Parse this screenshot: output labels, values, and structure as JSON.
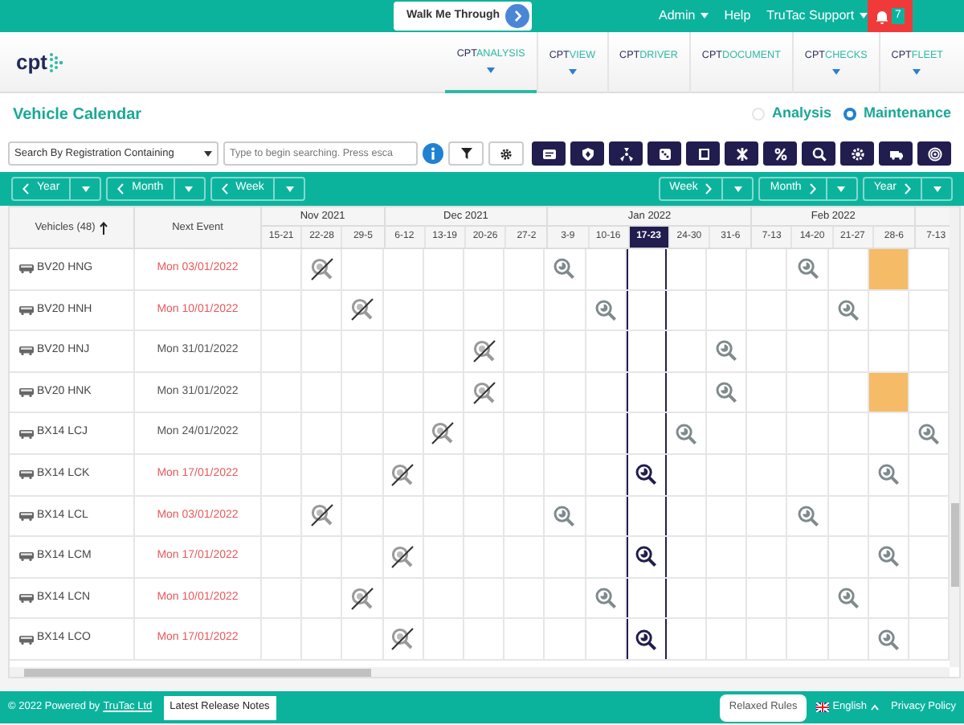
{
  "top_bar": {
    "walkthrough": "Walk Me Through",
    "menus": [
      {
        "label": "Admin",
        "dropdown": true
      },
      {
        "label": "Help",
        "dropdown": false
      },
      {
        "label": "TruTac Support",
        "dropdown": true
      }
    ],
    "notifications": "7"
  },
  "logo": "cpt",
  "nav": [
    {
      "prefix": "CPT",
      "label": "ANALYSIS",
      "selected": true,
      "dropdown": true
    },
    {
      "prefix": "CPT",
      "label": "VIEW",
      "selected": false,
      "dropdown": true
    },
    {
      "prefix": "CPT",
      "label": "DRIVER",
      "selected": false,
      "dropdown": false
    },
    {
      "prefix": "CPT",
      "label": "DOCUMENT",
      "selected": false,
      "dropdown": false
    },
    {
      "prefix": "CPT",
      "label": "CHECKS",
      "selected": false,
      "dropdown": true
    },
    {
      "prefix": "CPT",
      "label": "FLEET",
      "selected": false,
      "dropdown": true
    }
  ],
  "page_title": "Vehicle Calendar",
  "modes": [
    {
      "label": "Analysis",
      "selected": false
    },
    {
      "label": "Maintenance",
      "selected": true
    }
  ],
  "search": {
    "mode": "Search By Registration Containing",
    "placeholder": "Type to begin searching. Press esca"
  },
  "period_nav": {
    "back": [
      {
        "label": "Year"
      },
      {
        "label": "Month"
      },
      {
        "label": "Week"
      }
    ],
    "forward": [
      {
        "label": "Week"
      },
      {
        "label": "Month"
      },
      {
        "label": "Year"
      }
    ]
  },
  "calendar": {
    "columns": {
      "vehicles": "Vehicles (48)",
      "next_event": "Next Event"
    },
    "months": [
      {
        "label": "Nov 2021",
        "weeks": [
          {
            "label": "15-21",
            "selected": false
          },
          {
            "label": "22-28",
            "selected": false
          },
          {
            "label": "29-5",
            "selected": false
          }
        ]
      },
      {
        "label": "Dec 2021",
        "weeks": [
          {
            "label": "6-12",
            "selected": false
          },
          {
            "label": "13-19",
            "selected": false
          },
          {
            "label": "20-26",
            "selected": false
          },
          {
            "label": "27-2",
            "selected": false
          }
        ]
      },
      {
        "label": "Jan 2022",
        "weeks": [
          {
            "label": "3-9",
            "selected": false
          },
          {
            "label": "10-16",
            "selected": false
          },
          {
            "label": "17-23",
            "selected": true
          },
          {
            "label": "24-30",
            "selected": false
          },
          {
            "label": "31-6",
            "selected": false
          }
        ]
      },
      {
        "label": "Feb 2022",
        "weeks": [
          {
            "label": "7-13",
            "selected": false
          },
          {
            "label": "14-20",
            "selected": false
          },
          {
            "label": "21-27",
            "selected": false
          },
          {
            "label": "28-6",
            "selected": false
          }
        ]
      },
      {
        "weeks": [
          {
            "label": "7-13",
            "selected": false
          }
        ]
      }
    ],
    "rows": [
      {
        "vehicle": "BV20 HNG",
        "next_event": "Mon 03/01/2022",
        "overdue": true,
        "cells": [
          {
            "kind": "none"
          },
          {
            "kind": "cancelled"
          },
          {
            "kind": "none"
          },
          {
            "kind": "none"
          },
          {
            "kind": "none"
          },
          {
            "kind": "none"
          },
          {
            "kind": "none"
          },
          {
            "kind": "inspection"
          },
          {
            "kind": "none"
          },
          {
            "kind": "none"
          },
          {
            "kind": "none"
          },
          {
            "kind": "none"
          },
          {
            "kind": "none"
          },
          {
            "kind": "inspection"
          },
          {
            "kind": "none"
          },
          {
            "kind": "due"
          },
          {
            "kind": "none"
          }
        ]
      },
      {
        "vehicle": "BV20 HNH",
        "next_event": "Mon 10/01/2022",
        "overdue": true,
        "cells": [
          {
            "kind": "none"
          },
          {
            "kind": "none"
          },
          {
            "kind": "cancelled"
          },
          {
            "kind": "none"
          },
          {
            "kind": "none"
          },
          {
            "kind": "none"
          },
          {
            "kind": "none"
          },
          {
            "kind": "none"
          },
          {
            "kind": "inspection"
          },
          {
            "kind": "none"
          },
          {
            "kind": "none"
          },
          {
            "kind": "none"
          },
          {
            "kind": "none"
          },
          {
            "kind": "none"
          },
          {
            "kind": "inspection"
          },
          {
            "kind": "none"
          },
          {
            "kind": "none"
          }
        ]
      },
      {
        "vehicle": "BV20 HNJ",
        "next_event": "Mon 31/01/2022",
        "overdue": false,
        "cells": [
          {
            "kind": "none"
          },
          {
            "kind": "none"
          },
          {
            "kind": "none"
          },
          {
            "kind": "none"
          },
          {
            "kind": "none"
          },
          {
            "kind": "cancelled"
          },
          {
            "kind": "none"
          },
          {
            "kind": "none"
          },
          {
            "kind": "none"
          },
          {
            "kind": "none"
          },
          {
            "kind": "none"
          },
          {
            "kind": "inspection"
          },
          {
            "kind": "none"
          },
          {
            "kind": "none"
          },
          {
            "kind": "none"
          },
          {
            "kind": "none"
          },
          {
            "kind": "none"
          }
        ]
      },
      {
        "vehicle": "BV20 HNK",
        "next_event": "Mon 31/01/2022",
        "overdue": false,
        "cells": [
          {
            "kind": "none"
          },
          {
            "kind": "none"
          },
          {
            "kind": "none"
          },
          {
            "kind": "none"
          },
          {
            "kind": "none"
          },
          {
            "kind": "cancelled"
          },
          {
            "kind": "none"
          },
          {
            "kind": "none"
          },
          {
            "kind": "none"
          },
          {
            "kind": "none"
          },
          {
            "kind": "none"
          },
          {
            "kind": "inspection"
          },
          {
            "kind": "none"
          },
          {
            "kind": "none"
          },
          {
            "kind": "none"
          },
          {
            "kind": "due"
          },
          {
            "kind": "none"
          }
        ]
      },
      {
        "vehicle": "BX14 LCJ",
        "next_event": "Mon 24/01/2022",
        "overdue": false,
        "cells": [
          {
            "kind": "none"
          },
          {
            "kind": "none"
          },
          {
            "kind": "none"
          },
          {
            "kind": "none"
          },
          {
            "kind": "cancelled"
          },
          {
            "kind": "none"
          },
          {
            "kind": "none"
          },
          {
            "kind": "none"
          },
          {
            "kind": "none"
          },
          {
            "kind": "none"
          },
          {
            "kind": "inspection"
          },
          {
            "kind": "none"
          },
          {
            "kind": "none"
          },
          {
            "kind": "none"
          },
          {
            "kind": "none"
          },
          {
            "kind": "none"
          },
          {
            "kind": "inspection"
          }
        ]
      },
      {
        "vehicle": "BX14 LCK",
        "next_event": "Mon 17/01/2022",
        "overdue": true,
        "cells": [
          {
            "kind": "none"
          },
          {
            "kind": "none"
          },
          {
            "kind": "none"
          },
          {
            "kind": "cancelled"
          },
          {
            "kind": "none"
          },
          {
            "kind": "none"
          },
          {
            "kind": "none"
          },
          {
            "kind": "none"
          },
          {
            "kind": "none"
          },
          {
            "kind": "inspection"
          },
          {
            "kind": "none"
          },
          {
            "kind": "none"
          },
          {
            "kind": "none"
          },
          {
            "kind": "none"
          },
          {
            "kind": "none"
          },
          {
            "kind": "inspection"
          },
          {
            "kind": "none"
          }
        ]
      },
      {
        "vehicle": "BX14 LCL",
        "next_event": "Mon 03/01/2022",
        "overdue": true,
        "cells": [
          {
            "kind": "none"
          },
          {
            "kind": "cancelled"
          },
          {
            "kind": "none"
          },
          {
            "kind": "none"
          },
          {
            "kind": "none"
          },
          {
            "kind": "none"
          },
          {
            "kind": "none"
          },
          {
            "kind": "inspection"
          },
          {
            "kind": "none"
          },
          {
            "kind": "none"
          },
          {
            "kind": "none"
          },
          {
            "kind": "none"
          },
          {
            "kind": "none"
          },
          {
            "kind": "inspection"
          },
          {
            "kind": "none"
          },
          {
            "kind": "none"
          },
          {
            "kind": "none"
          }
        ]
      },
      {
        "vehicle": "BX14 LCM",
        "next_event": "Mon 17/01/2022",
        "overdue": true,
        "cells": [
          {
            "kind": "none"
          },
          {
            "kind": "none"
          },
          {
            "kind": "none"
          },
          {
            "kind": "cancelled"
          },
          {
            "kind": "none"
          },
          {
            "kind": "none"
          },
          {
            "kind": "none"
          },
          {
            "kind": "none"
          },
          {
            "kind": "none"
          },
          {
            "kind": "inspection"
          },
          {
            "kind": "none"
          },
          {
            "kind": "none"
          },
          {
            "kind": "none"
          },
          {
            "kind": "none"
          },
          {
            "kind": "none"
          },
          {
            "kind": "inspection"
          },
          {
            "kind": "none"
          }
        ]
      },
      {
        "vehicle": "BX14 LCN",
        "next_event": "Mon 10/01/2022",
        "overdue": true,
        "cells": [
          {
            "kind": "none"
          },
          {
            "kind": "none"
          },
          {
            "kind": "cancelled"
          },
          {
            "kind": "none"
          },
          {
            "kind": "none"
          },
          {
            "kind": "none"
          },
          {
            "kind": "none"
          },
          {
            "kind": "none"
          },
          {
            "kind": "inspection"
          },
          {
            "kind": "none"
          },
          {
            "kind": "none"
          },
          {
            "kind": "none"
          },
          {
            "kind": "none"
          },
          {
            "kind": "none"
          },
          {
            "kind": "inspection"
          },
          {
            "kind": "none"
          },
          {
            "kind": "none"
          }
        ]
      },
      {
        "vehicle": "BX14 LCO",
        "next_event": "Mon 17/01/2022",
        "overdue": true,
        "cells": [
          {
            "kind": "none"
          },
          {
            "kind": "none"
          },
          {
            "kind": "none"
          },
          {
            "kind": "cancelled"
          },
          {
            "kind": "none"
          },
          {
            "kind": "none"
          },
          {
            "kind": "none"
          },
          {
            "kind": "none"
          },
          {
            "kind": "none"
          },
          {
            "kind": "inspection"
          },
          {
            "kind": "none"
          },
          {
            "kind": "none"
          },
          {
            "kind": "none"
          },
          {
            "kind": "none"
          },
          {
            "kind": "none"
          },
          {
            "kind": "inspection"
          },
          {
            "kind": "none"
          }
        ]
      }
    ]
  },
  "footer": {
    "copyright": "© 2022 Powered by",
    "company_link": "TruTac Ltd",
    "release_notes": "Latest Release Notes",
    "rules": "Relaxed Rules",
    "language": "English",
    "privacy": "Privacy Policy"
  }
}
